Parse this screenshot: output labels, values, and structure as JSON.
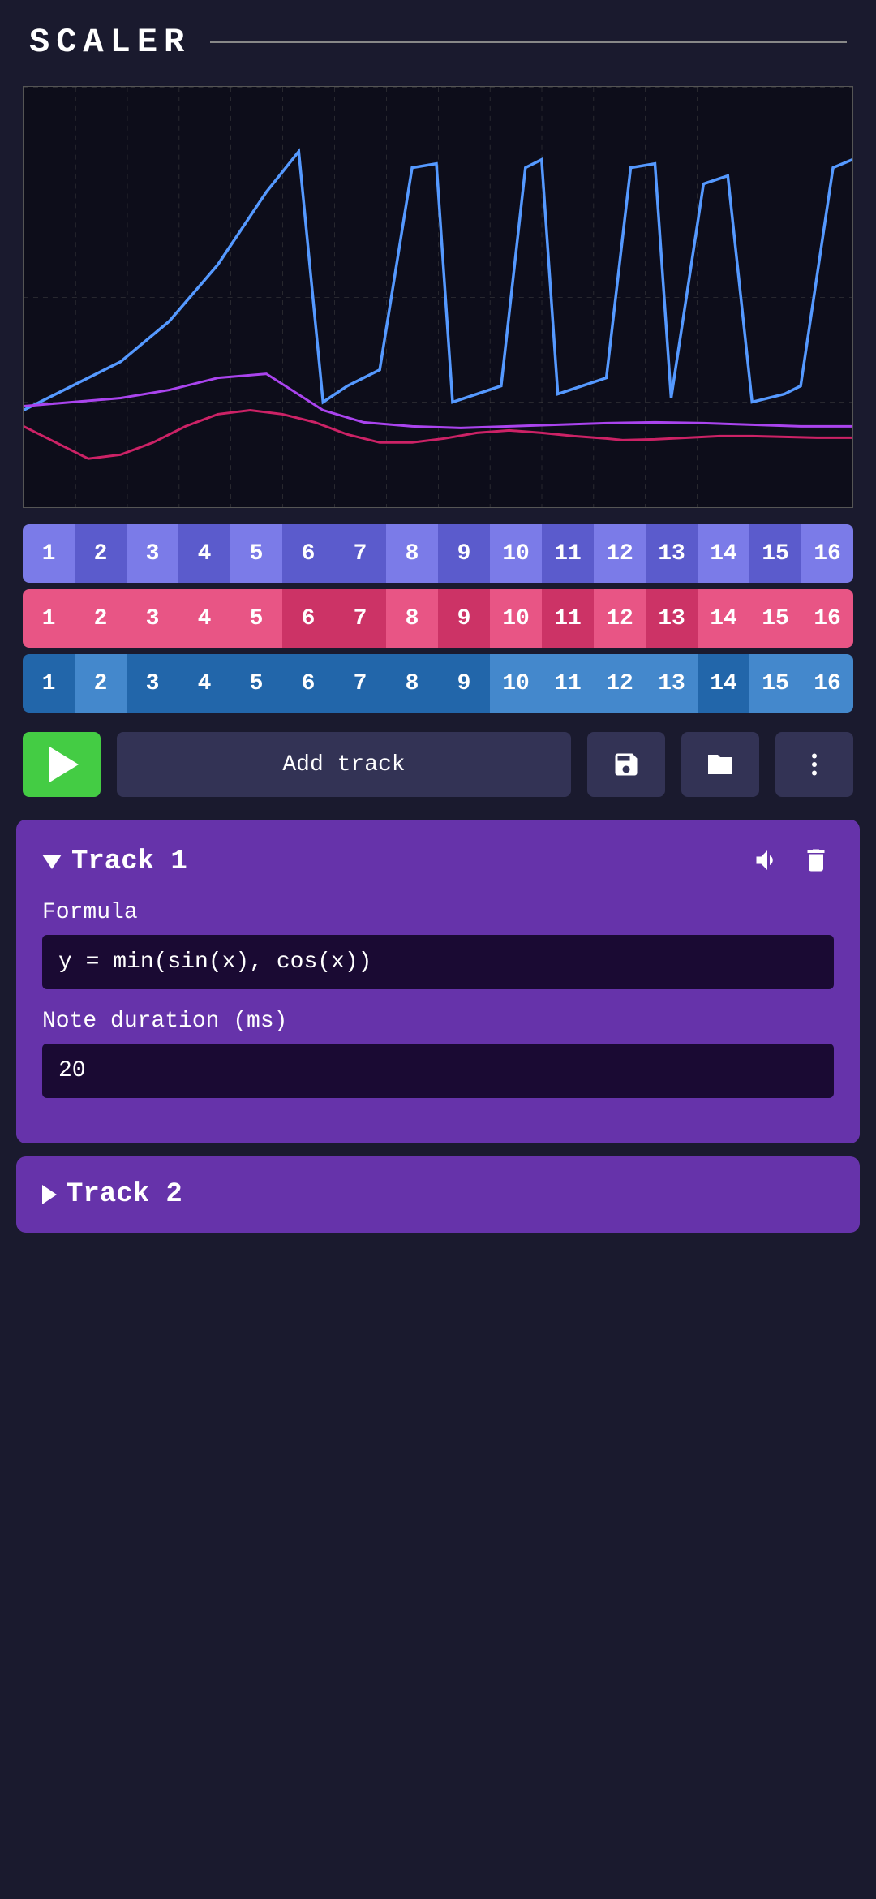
{
  "header": {
    "title": "SCALER"
  },
  "chart": {
    "aria": "Mathematical function chart showing sin, cos, and combined wave forms"
  },
  "beat_rows": [
    {
      "id": "row1",
      "cells": [
        {
          "num": "1",
          "active": true
        },
        {
          "num": "2",
          "active": false
        },
        {
          "num": "3",
          "active": true
        },
        {
          "num": "4",
          "active": false
        },
        {
          "num": "5",
          "active": true
        },
        {
          "num": "6",
          "active": false
        },
        {
          "num": "7",
          "active": false
        },
        {
          "num": "8",
          "active": true
        },
        {
          "num": "9",
          "active": false
        },
        {
          "num": "10",
          "active": true
        },
        {
          "num": "11",
          "active": false
        },
        {
          "num": "12",
          "active": true
        },
        {
          "num": "13",
          "active": false
        },
        {
          "num": "14",
          "active": true
        },
        {
          "num": "15",
          "active": false
        },
        {
          "num": "16",
          "active": true
        }
      ]
    },
    {
      "id": "row2",
      "cells": [
        {
          "num": "1",
          "active": true
        },
        {
          "num": "2",
          "active": true
        },
        {
          "num": "3",
          "active": true
        },
        {
          "num": "4",
          "active": true
        },
        {
          "num": "5",
          "active": true
        },
        {
          "num": "6",
          "active": false
        },
        {
          "num": "7",
          "active": false
        },
        {
          "num": "8",
          "active": true
        },
        {
          "num": "9",
          "active": false
        },
        {
          "num": "10",
          "active": true
        },
        {
          "num": "11",
          "active": false
        },
        {
          "num": "12",
          "active": true
        },
        {
          "num": "13",
          "active": false
        },
        {
          "num": "14",
          "active": true
        },
        {
          "num": "15",
          "active": true
        },
        {
          "num": "16",
          "active": true
        }
      ]
    },
    {
      "id": "row3",
      "cells": [
        {
          "num": "1",
          "active": false
        },
        {
          "num": "2",
          "active": true
        },
        {
          "num": "3",
          "active": false
        },
        {
          "num": "4",
          "active": false
        },
        {
          "num": "5",
          "active": false
        },
        {
          "num": "6",
          "active": false
        },
        {
          "num": "7",
          "active": false
        },
        {
          "num": "8",
          "active": false
        },
        {
          "num": "9",
          "active": false
        },
        {
          "num": "10",
          "active": true
        },
        {
          "num": "11",
          "active": true
        },
        {
          "num": "12",
          "active": true
        },
        {
          "num": "13",
          "active": true
        },
        {
          "num": "14",
          "active": false
        },
        {
          "num": "15",
          "active": true
        },
        {
          "num": "16",
          "active": true
        }
      ]
    }
  ],
  "controls": {
    "play_label": "▶",
    "add_track_label": "Add track"
  },
  "track1": {
    "label": "Track 1",
    "expanded": true,
    "formula_label": "Formula",
    "formula_value": "y = min(sin(x), cos(x))",
    "duration_label": "Note duration (ms)",
    "duration_value": "20"
  },
  "track2": {
    "label": "Track 2",
    "expanded": false
  }
}
